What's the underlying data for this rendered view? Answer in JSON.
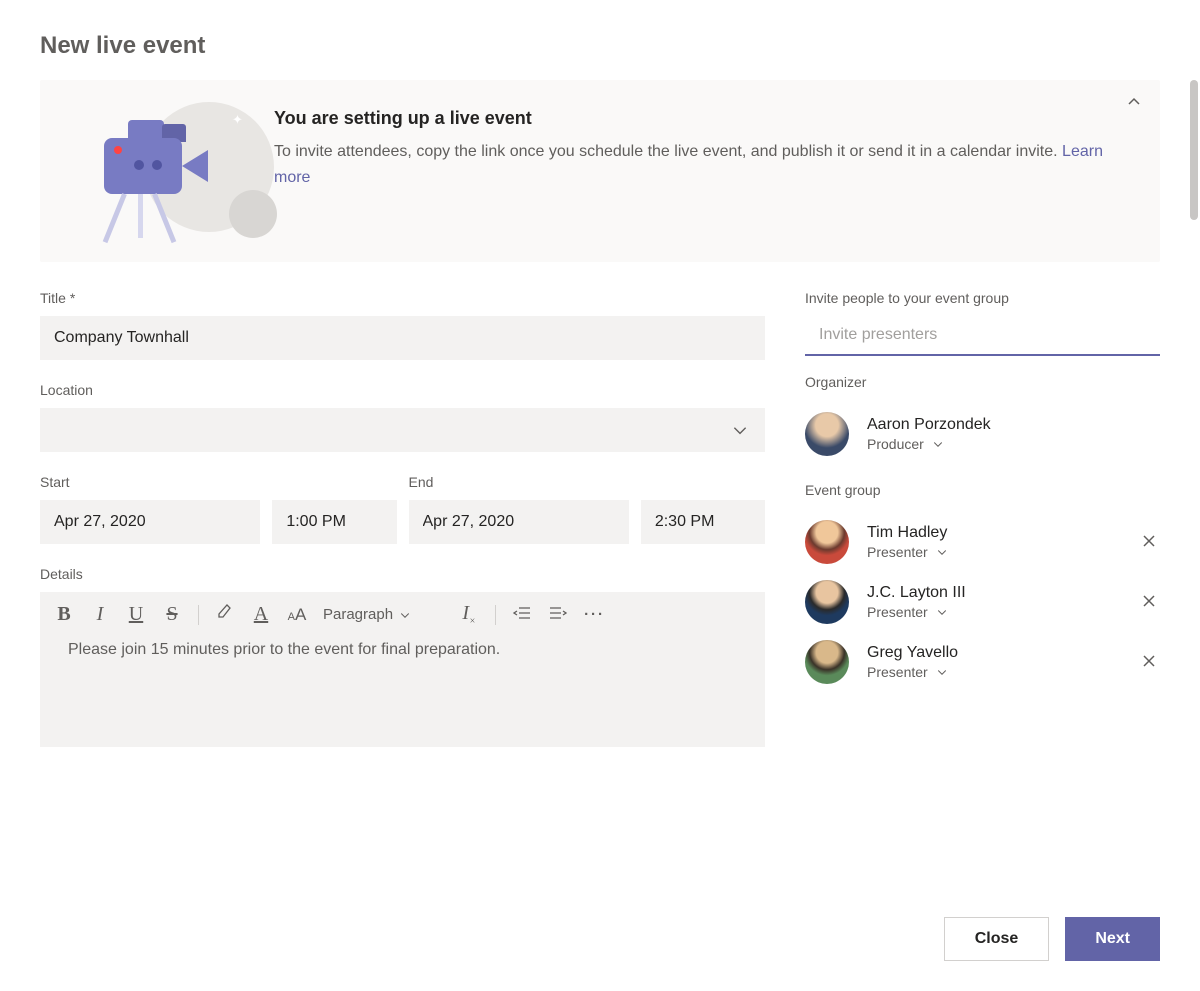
{
  "pageTitle": "New live event",
  "banner": {
    "title": "You are setting up a live event",
    "desc": "To invite attendees, copy the link once you schedule the live event, and publish it or send it in a calendar invite. ",
    "learnMore": "Learn more"
  },
  "labels": {
    "title": "Title *",
    "location": "Location",
    "start": "Start",
    "end": "End",
    "details": "Details",
    "invite": "Invite people to your event group",
    "organizerSec": "Organizer",
    "eventGroupSec": "Event group"
  },
  "fields": {
    "title": "Company Townhall",
    "location": "",
    "startDate": "Apr 27, 2020",
    "startTime": "1:00 PM",
    "endDate": "Apr 27, 2020",
    "endTime": "2:30 PM",
    "detailsBody": "Please join 15 minutes prior to the event for final preparation.",
    "invitePlaceholder": "Invite presenters"
  },
  "toolbar": {
    "bold": "B",
    "italic": "I",
    "underline": "U",
    "strike": "S",
    "highlight": "◬",
    "fontcolor": "A",
    "fontsize": "ᴀA",
    "paragraph": "Paragraph",
    "clear": "Iₓ",
    "outdent": "⇠",
    "indent": "⇢",
    "more": "···"
  },
  "organizer": {
    "name": "Aaron Porzondek",
    "role": "Producer"
  },
  "eventGroup": [
    {
      "name": "Tim Hadley",
      "role": "Presenter"
    },
    {
      "name": "J.C. Layton III",
      "role": "Presenter"
    },
    {
      "name": "Greg Yavello",
      "role": "Presenter"
    }
  ],
  "footer": {
    "close": "Close",
    "next": "Next"
  }
}
